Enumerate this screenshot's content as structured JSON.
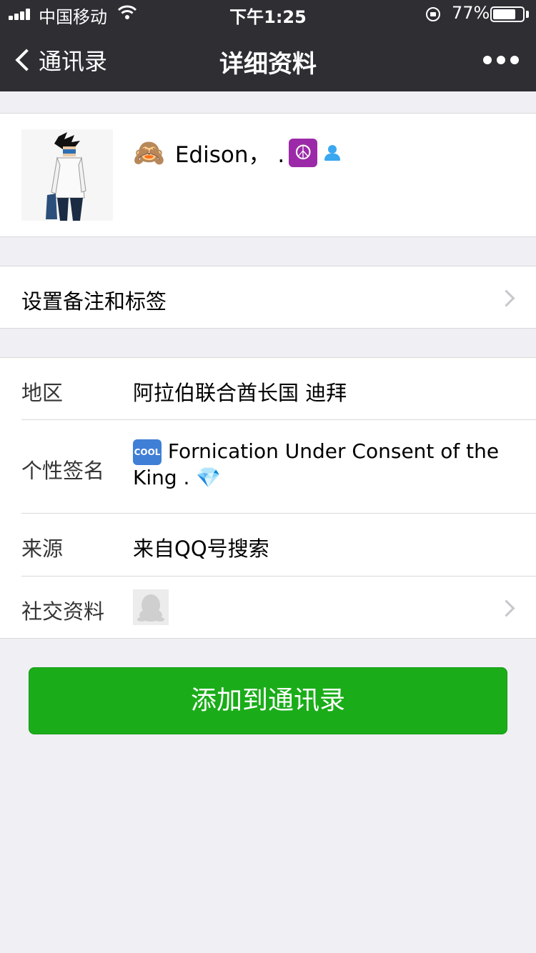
{
  "status": {
    "carrier": "中国移动",
    "time": "下午1:25",
    "battery_pct": "77%",
    "battery_level": 0.77
  },
  "nav": {
    "back_label": "通讯录",
    "title": "详细资料",
    "more_icon": "more-dots-icon"
  },
  "profile": {
    "name_emoji": "🙈",
    "name": "Edison，  .",
    "peace_symbol": "☮",
    "gender_icon": "male-icon"
  },
  "remark": {
    "label": "设置备注和标签"
  },
  "info": {
    "region_label": "地区",
    "region_value": "阿拉伯联合酋长国 迪拜",
    "signature_label": "个性签名",
    "signature_cool": "COOL",
    "signature_text": "Fornication Under Consent   of the   King     .",
    "signature_gem": "💎",
    "source_label": "来源",
    "source_value": "来自QQ号搜索",
    "social_label": "社交资料"
  },
  "add_button": {
    "label": "添加到通讯录",
    "color": "#1aad19"
  }
}
